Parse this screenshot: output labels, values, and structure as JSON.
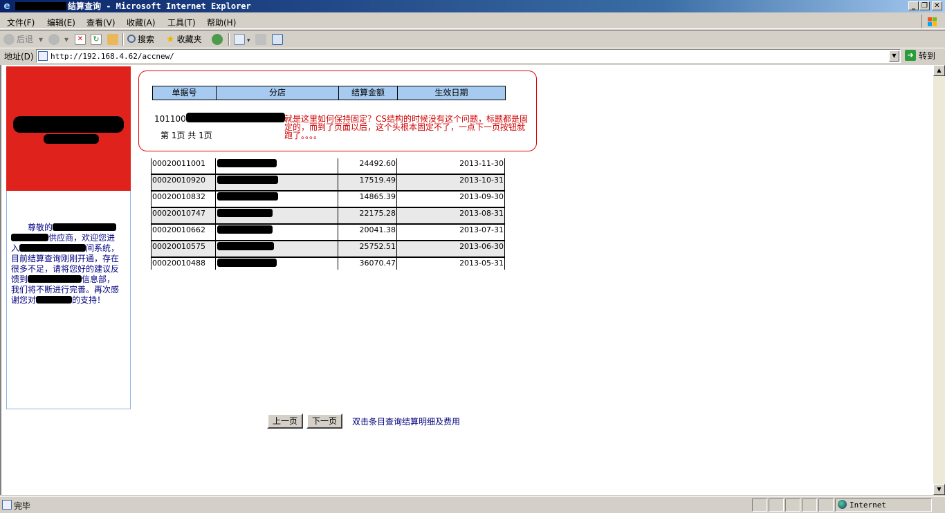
{
  "window": {
    "title": "结算查询 - Microsoft Internet Explorer",
    "minimize": "_",
    "restore": "❐",
    "close": "✕"
  },
  "menu": [
    "文件(F)",
    "编辑(E)",
    "查看(V)",
    "收藏(A)",
    "工具(T)",
    "帮助(H)"
  ],
  "toolbar": {
    "back": "后退",
    "search": "搜索",
    "favorites": "收藏夹"
  },
  "address": {
    "label": "地址(D)",
    "url": "http://192.168.4.62/accnew/",
    "go": "转到"
  },
  "notice": {
    "p1": "尊敬的",
    "p2": "供应商，欢迎您进入",
    "p3": "间系统，目前结算查询刚刚开通，存在很多不足，请将您好的建议反馈到",
    "p4": "信息部，我们将不断进行完善。再次感谢您对",
    "p5": "的支持！"
  },
  "table": {
    "headers": [
      "单据号",
      "分店",
      "结算金额",
      "生效日期"
    ],
    "preview_id": "1011002",
    "rows": [
      {
        "id": "00020011001",
        "amount": "24492.60",
        "date": "2013-11-30"
      },
      {
        "id": "00020010920",
        "amount": "17519.49",
        "date": "2013-10-31"
      },
      {
        "id": "00020010832",
        "amount": "14865.39",
        "date": "2013-09-30"
      },
      {
        "id": "00020010747",
        "amount": "22175.28",
        "date": "2013-08-31"
      },
      {
        "id": "00020010662",
        "amount": "20041.38",
        "date": "2013-07-31"
      },
      {
        "id": "00020010575",
        "amount": "25752.51",
        "date": "2013-06-30"
      },
      {
        "id": "00020010488",
        "amount": "36070.47",
        "date": "2013-05-31"
      }
    ]
  },
  "callout_note": "就是这里如何保持固定？CS结构的时候没有这个问题，标题都是固定的，而到了页面以后，这个头根本固定不了，一点下一页按钮就跑了。。。。",
  "pager": {
    "text": "第 1页 共 1页",
    "prev": "上一页",
    "next": "下一页",
    "hint": "双击条目查询结算明细及费用"
  },
  "status": {
    "text": "完毕",
    "zone": "Internet"
  },
  "colors": {
    "banner": "#e0221d",
    "header_bg": "#a6caf0",
    "note": "#d00000"
  }
}
